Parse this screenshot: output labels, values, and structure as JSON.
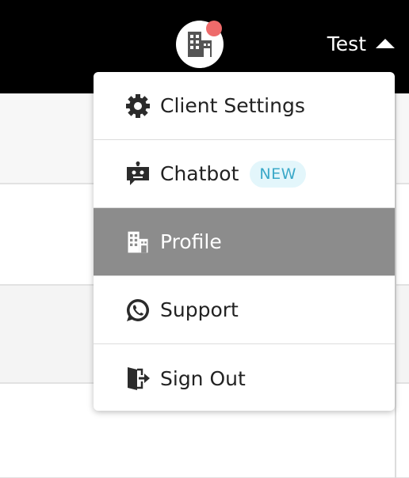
{
  "header": {
    "user_name": "Test",
    "notification_color": "#ee6b6b",
    "avatar_icon": "building-icon"
  },
  "menu": {
    "items": [
      {
        "label": "Client Settings",
        "icon": "gear-icon"
      },
      {
        "label": "Chatbot",
        "icon": "chatbot-icon",
        "badge": "NEW"
      },
      {
        "label": "Profile",
        "icon": "building-icon",
        "active": true
      },
      {
        "label": "Support",
        "icon": "whatsapp-icon"
      },
      {
        "label": "Sign Out",
        "icon": "sign-out-icon"
      }
    ]
  },
  "colors": {
    "header_bg": "#000000",
    "active_item_bg": "#8c8c8c",
    "badge_bg": "#e3f6fb",
    "badge_text": "#3aa8c8"
  }
}
